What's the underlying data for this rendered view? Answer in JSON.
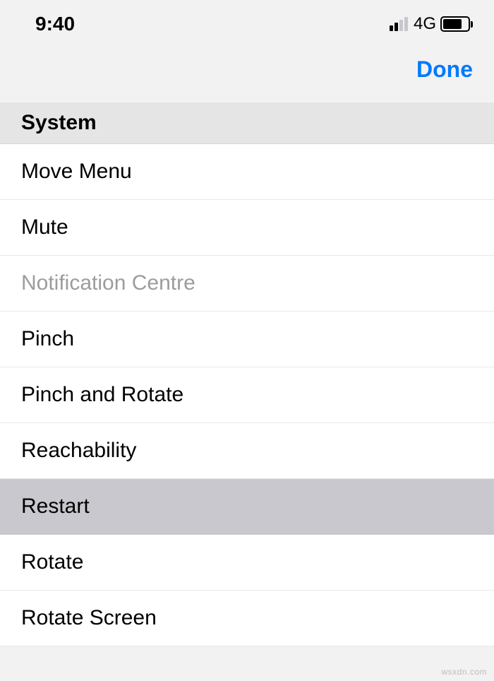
{
  "status": {
    "time": "9:40",
    "network": "4G"
  },
  "nav": {
    "done": "Done"
  },
  "section": {
    "title": "System"
  },
  "items": [
    {
      "label": "Move Menu",
      "disabled": false,
      "selected": false
    },
    {
      "label": "Mute",
      "disabled": false,
      "selected": false
    },
    {
      "label": "Notification Centre",
      "disabled": true,
      "selected": false
    },
    {
      "label": "Pinch",
      "disabled": false,
      "selected": false
    },
    {
      "label": "Pinch and Rotate",
      "disabled": false,
      "selected": false
    },
    {
      "label": "Reachability",
      "disabled": false,
      "selected": false
    },
    {
      "label": "Restart",
      "disabled": false,
      "selected": true
    },
    {
      "label": "Rotate",
      "disabled": false,
      "selected": false
    },
    {
      "label": "Rotate Screen",
      "disabled": false,
      "selected": false
    }
  ],
  "watermark": "wsxdn.com"
}
